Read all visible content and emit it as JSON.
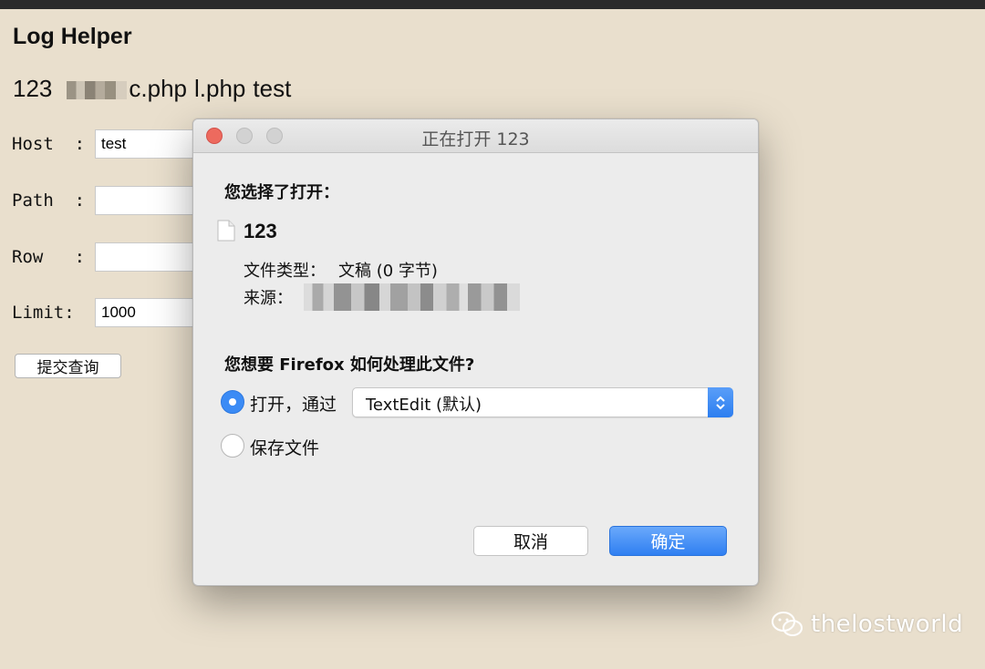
{
  "page": {
    "title": "Log Helper",
    "links": [
      "123",
      "c.php",
      "l.php",
      "test"
    ],
    "form": {
      "host_label": "Host  :",
      "host_value": "test",
      "path_label": "Path  :",
      "path_value": "",
      "row_label": "Row   :",
      "row_value": "",
      "limit_label": "Limit:",
      "limit_value": "1000",
      "submit_label": "提交查询"
    }
  },
  "dialog": {
    "title": "正在打开 123",
    "heading": "您选择了打开：",
    "file_name": "123",
    "file_type_label": "文件类型：",
    "file_type_value": "文稿 (0 字节)",
    "source_label": "来源：",
    "question": "您想要 Firefox 如何处理此文件?",
    "option_open_label": "打开，通过",
    "option_open_selected": true,
    "open_with_value": "TextEdit (默认)",
    "option_save_label": "保存文件",
    "cancel_label": "取消",
    "ok_label": "确定",
    "colors": {
      "accent": "#3b8bf5",
      "close": "#ed6a5e"
    }
  },
  "watermark": "thelostworld"
}
